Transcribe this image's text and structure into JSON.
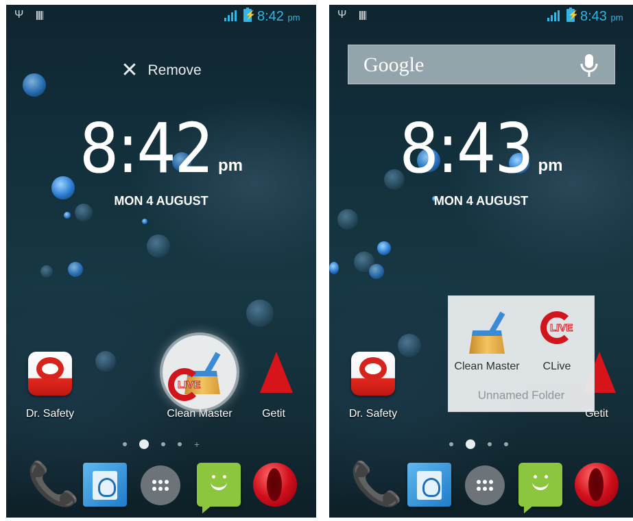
{
  "screens": [
    {
      "status": {
        "time": "8:42",
        "ampm": "pm"
      },
      "remove_label": "Remove",
      "clock": {
        "time": "8:42",
        "ampm": "pm",
        "date": "MON 4 AUGUST"
      },
      "apps": {
        "left": "Dr. Safety",
        "middle": "Clean Master",
        "right": "Getit"
      },
      "dragged_icon_label": "LIVE"
    },
    {
      "status": {
        "time": "8:43",
        "ampm": "pm"
      },
      "search": {
        "logo": "Google"
      },
      "clock": {
        "time": "8:43",
        "ampm": "pm",
        "date": "MON 4 AUGUST"
      },
      "apps": {
        "left": "Dr. Safety",
        "right": "Getit"
      },
      "folder": {
        "items": [
          {
            "label": "Clean Master"
          },
          {
            "label": "CLive",
            "badge": "LIVE"
          }
        ],
        "name": "Unnamed Folder"
      }
    }
  ],
  "dock": [
    "phone-icon",
    "contacts-icon",
    "app-drawer-icon",
    "messaging-icon",
    "opera-icon"
  ],
  "colors": {
    "accent": "#33b5e5",
    "wallpaper": "#163743"
  }
}
